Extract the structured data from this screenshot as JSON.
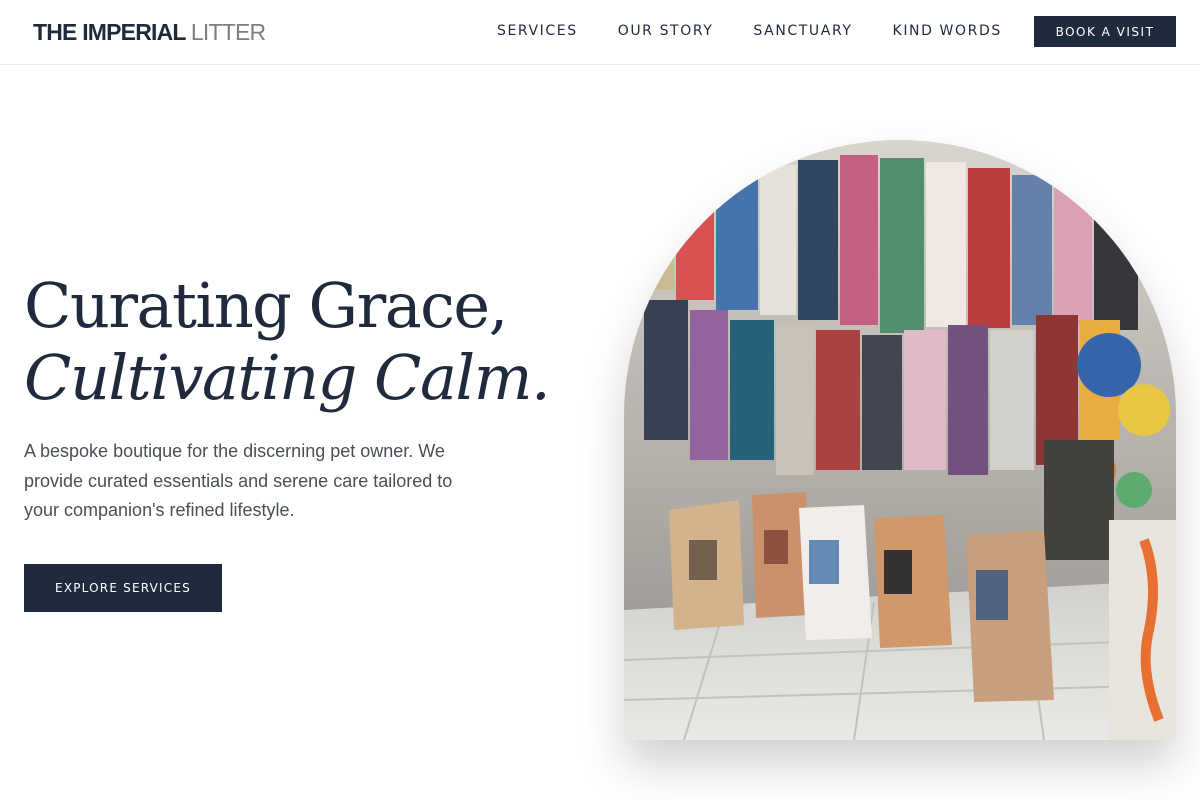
{
  "brand": {
    "name_bold": "THE IMPERIAL",
    "name_light": "LITTER"
  },
  "nav": {
    "links": [
      "SERVICES",
      "OUR STORY",
      "SANCTUARY",
      "KIND WORDS"
    ],
    "cta_label": "BOOK A VISIT"
  },
  "hero": {
    "title_line1": "Curating Grace,",
    "title_line2": "Cultivating Calm.",
    "description": "A bespoke boutique for the discerning pet owner. We provide curated essentials and serene care tailored to your companion's refined lifestyle.",
    "button_label": "EXPLORE SERVICES"
  },
  "colors": {
    "navy": "#1f2a3c",
    "gray_text": "#4a4f57",
    "logo_gray": "#7b7e84"
  },
  "image": {
    "subject": "pet-shop-photo"
  }
}
